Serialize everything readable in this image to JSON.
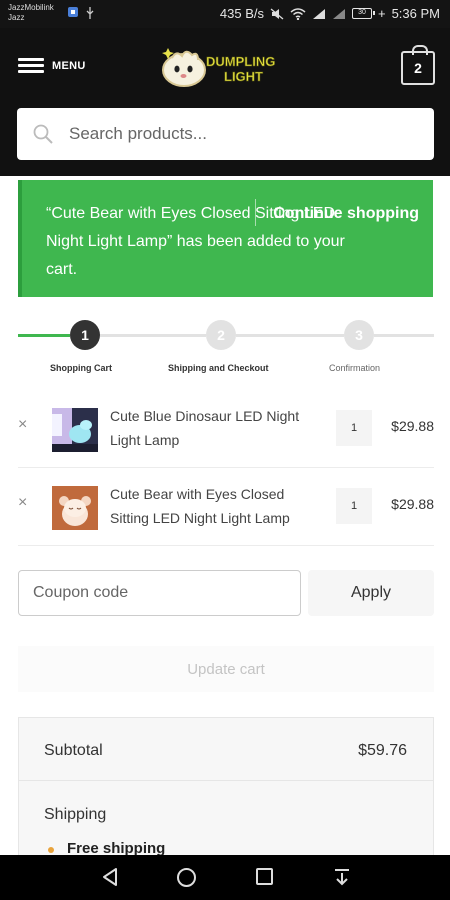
{
  "status_bar": {
    "carrier_line1": "JazzMobilink",
    "carrier_line2": "Jazz",
    "speed": "435 B/s",
    "battery": "30",
    "time": "5:36 PM"
  },
  "header": {
    "menu_label": "MENU",
    "logo_line1": "DUMPLING",
    "logo_line2": "LIGHT",
    "cart_count": "2",
    "search_placeholder": "Search products..."
  },
  "notice": {
    "message": "“Cute Bear with Eyes Closed Sitting LED Night Light Lamp” has been added to your cart.",
    "link": "Continue shopping"
  },
  "steps": [
    {
      "number": "1",
      "label": "Shopping Cart"
    },
    {
      "number": "2",
      "label": "Shipping and Checkout"
    },
    {
      "number": "3",
      "label": "Confirmation"
    }
  ],
  "cart_items": [
    {
      "name": "Cute Blue Dinosaur LED Night Light Lamp",
      "qty": "1",
      "price": "$29.88"
    },
    {
      "name": "Cute Bear with Eyes Closed Sitting LED Night Light Lamp",
      "qty": "1",
      "price": "$29.88"
    }
  ],
  "remove_symbol": "×",
  "coupon": {
    "placeholder": "Coupon code",
    "apply_label": "Apply"
  },
  "update_label": "Update cart",
  "totals": {
    "subtotal_label": "Subtotal",
    "subtotal_value": "$59.76",
    "shipping_label": "Shipping",
    "shipping_option": "Free shipping"
  },
  "colors": {
    "notice_green": "#3fb74f",
    "active_step": "#333333",
    "inactive_step": "#e2e2e2",
    "progress_green": "#3fb74f"
  }
}
